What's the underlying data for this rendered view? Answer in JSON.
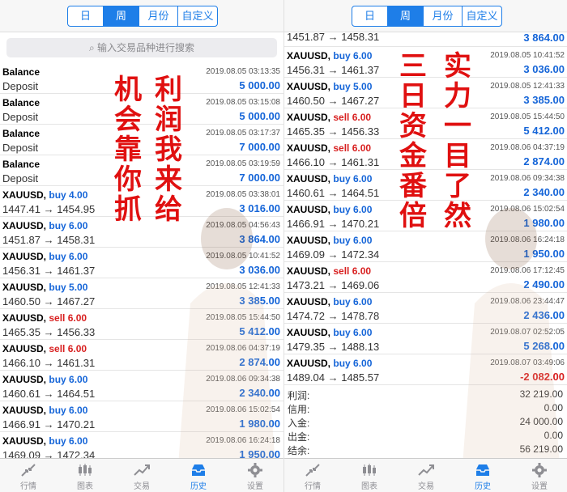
{
  "tabs_top": [
    "日",
    "周",
    "月份",
    "自定义"
  ],
  "active_top_tab": "周",
  "search_placeholder": "输入交易品种进行搜索",
  "left_rows": [
    {
      "l1a": "Balance",
      "l1b": "",
      "dir": "",
      "time": "2019.08.05 03:13:35",
      "l2": "Deposit",
      "amt": "5 000.00"
    },
    {
      "l1a": "Balance",
      "l1b": "",
      "dir": "",
      "time": "2019.08.05 03:15:08",
      "l2": "Deposit",
      "amt": "5 000.00"
    },
    {
      "l1a": "Balance",
      "l1b": "",
      "dir": "",
      "time": "2019.08.05 03:17:37",
      "l2": "Deposit",
      "amt": "7 000.00"
    },
    {
      "l1a": "Balance",
      "l1b": "",
      "dir": "",
      "time": "2019.08.05 03:19:59",
      "l2": "Deposit",
      "amt": "7 000.00"
    },
    {
      "l1a": "XAUUSD,",
      "l1b": "buy 4.00",
      "dir": "buy",
      "time": "2019.08.05 03:38:01",
      "l2": "1447.41 → 1454.95",
      "amt": "3 016.00"
    },
    {
      "l1a": "XAUUSD,",
      "l1b": "buy 6.00",
      "dir": "buy",
      "time": "2019.08.05 04:56:43",
      "l2": "1451.87 → 1458.31",
      "amt": "3 864.00"
    },
    {
      "l1a": "XAUUSD,",
      "l1b": "buy 6.00",
      "dir": "buy",
      "time": "2019.08.05 10:41:52",
      "l2": "1456.31 → 1461.37",
      "amt": "3 036.00"
    },
    {
      "l1a": "XAUUSD,",
      "l1b": "buy 5.00",
      "dir": "buy",
      "time": "2019.08.05 12:41:33",
      "l2": "1460.50 → 1467.27",
      "amt": "3 385.00"
    },
    {
      "l1a": "XAUUSD,",
      "l1b": "sell 6.00",
      "dir": "sell",
      "time": "2019.08.05 15:44:50",
      "l2": "1465.35 → 1456.33",
      "amt": "5 412.00"
    },
    {
      "l1a": "XAUUSD,",
      "l1b": "sell 6.00",
      "dir": "sell",
      "time": "2019.08.06 04:37:19",
      "l2": "1466.10 → 1461.31",
      "amt": "2 874.00"
    },
    {
      "l1a": "XAUUSD,",
      "l1b": "buy 6.00",
      "dir": "buy",
      "time": "2019.08.06 09:34:38",
      "l2": "1460.61 → 1464.51",
      "amt": "2 340.00"
    },
    {
      "l1a": "XAUUSD,",
      "l1b": "buy 6.00",
      "dir": "buy",
      "time": "2019.08.06 15:02:54",
      "l2": "1466.91 → 1470.21",
      "amt": "1 980.00"
    },
    {
      "l1a": "XAUUSD,",
      "l1b": "buy 6.00",
      "dir": "buy",
      "time": "2019.08.06 16:24:18",
      "l2": "1469.09 → 1472.34",
      "amt": "1 950.00"
    }
  ],
  "right_top_partial": {
    "l2": "1451.87 → 1458.31",
    "amt": "3 864.00"
  },
  "right_rows": [
    {
      "l1a": "XAUUSD,",
      "l1b": "buy 6.00",
      "dir": "buy",
      "time": "2019.08.05 10:41:52",
      "l2": "1456.31 → 1461.37",
      "amt": "3 036.00"
    },
    {
      "l1a": "XAUUSD,",
      "l1b": "buy 5.00",
      "dir": "buy",
      "time": "2019.08.05 12:41:33",
      "l2": "1460.50 → 1467.27",
      "amt": "3 385.00"
    },
    {
      "l1a": "XAUUSD,",
      "l1b": "sell 6.00",
      "dir": "sell",
      "time": "2019.08.05 15:44:50",
      "l2": "1465.35 → 1456.33",
      "amt": "5 412.00"
    },
    {
      "l1a": "XAUUSD,",
      "l1b": "sell 6.00",
      "dir": "sell",
      "time": "2019.08.06 04:37:19",
      "l2": "1466.10 → 1461.31",
      "amt": "2 874.00"
    },
    {
      "l1a": "XAUUSD,",
      "l1b": "buy 6.00",
      "dir": "buy",
      "time": "2019.08.06 09:34:38",
      "l2": "1460.61 → 1464.51",
      "amt": "2 340.00"
    },
    {
      "l1a": "XAUUSD,",
      "l1b": "buy 6.00",
      "dir": "buy",
      "time": "2019.08.06 15:02:54",
      "l2": "1466.91 → 1470.21",
      "amt": "1 980.00"
    },
    {
      "l1a": "XAUUSD,",
      "l1b": "buy 6.00",
      "dir": "buy",
      "time": "2019.08.06 16:24:18",
      "l2": "1469.09 → 1472.34",
      "amt": "1 950.00"
    },
    {
      "l1a": "XAUUSD,",
      "l1b": "sell 6.00",
      "dir": "sell",
      "time": "2019.08.06 17:12:45",
      "l2": "1473.21 → 1469.06",
      "amt": "2 490.00"
    },
    {
      "l1a": "XAUUSD,",
      "l1b": "buy 6.00",
      "dir": "buy",
      "time": "2019.08.06 23:44:47",
      "l2": "1474.72 → 1478.78",
      "amt": "2 436.00"
    },
    {
      "l1a": "XAUUSD,",
      "l1b": "buy 6.00",
      "dir": "buy",
      "time": "2019.08.07 02:52:05",
      "l2": "1479.35 → 1488.13",
      "amt": "5 268.00"
    },
    {
      "l1a": "XAUUSD,",
      "l1b": "buy 6.00",
      "dir": "buy",
      "time": "2019.08.07 03:49:06",
      "l2": "1489.04 → 1485.57",
      "amt": "-2 082.00"
    }
  ],
  "summary": [
    {
      "label": "利润:",
      "value": "32 219.00"
    },
    {
      "label": "信用:",
      "value": "0.00"
    },
    {
      "label": "入金:",
      "value": "24 000.00"
    },
    {
      "label": "出金:",
      "value": "0.00"
    },
    {
      "label": "结余:",
      "value": "56 219.00"
    }
  ],
  "bottom_tabs": [
    {
      "label": "行情",
      "icon": "arrows-icon"
    },
    {
      "label": "图表",
      "icon": "candlestick-icon"
    },
    {
      "label": "交易",
      "icon": "trend-icon"
    },
    {
      "label": "历史",
      "icon": "inbox-icon"
    },
    {
      "label": "设置",
      "icon": "gear-icon"
    }
  ],
  "active_bottom_tab": "历史",
  "overlay_left": [
    "机会靠你抓",
    "利润我来给"
  ],
  "overlay_right": [
    "三日资金番倍",
    "实力一目了然"
  ],
  "colors": {
    "accent": "#1e7ee8",
    "buy": "#1565d8",
    "sell": "#d81f1f",
    "overlay": "#e01010"
  }
}
